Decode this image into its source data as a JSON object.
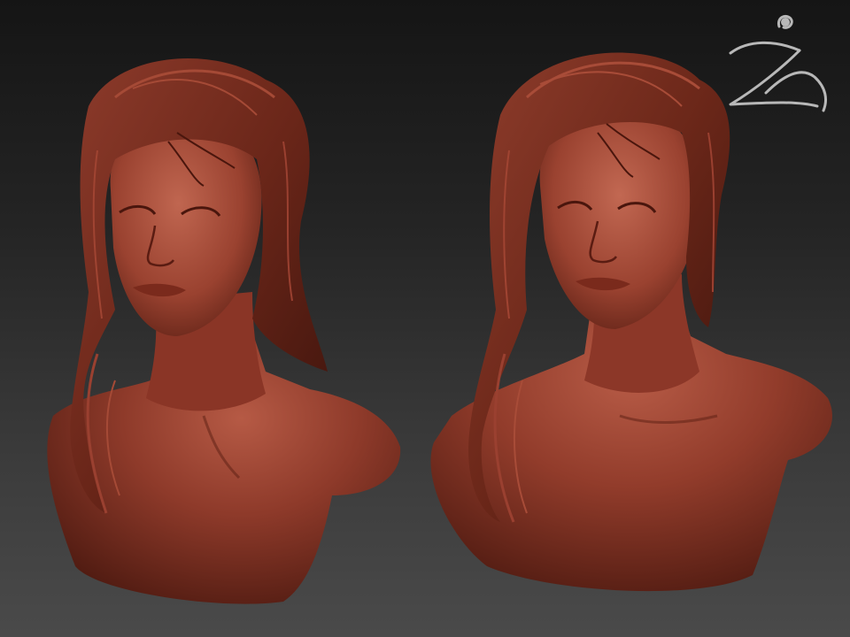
{
  "viewport": {
    "background_top": "#151515",
    "background_bottom": "#4a4a4a"
  },
  "models": [
    {
      "icon": "clay-bust-female-icon",
      "view": "front-three-quarter"
    },
    {
      "icon": "clay-bust-female-icon",
      "view": "three-quarter-right"
    }
  ],
  "material": {
    "base": "#8a3526",
    "highlight": "#c0604a",
    "shadow": "#3e140d"
  },
  "logo": {
    "icon": "zbrush-logo-icon",
    "color": "#b8b8b8"
  }
}
